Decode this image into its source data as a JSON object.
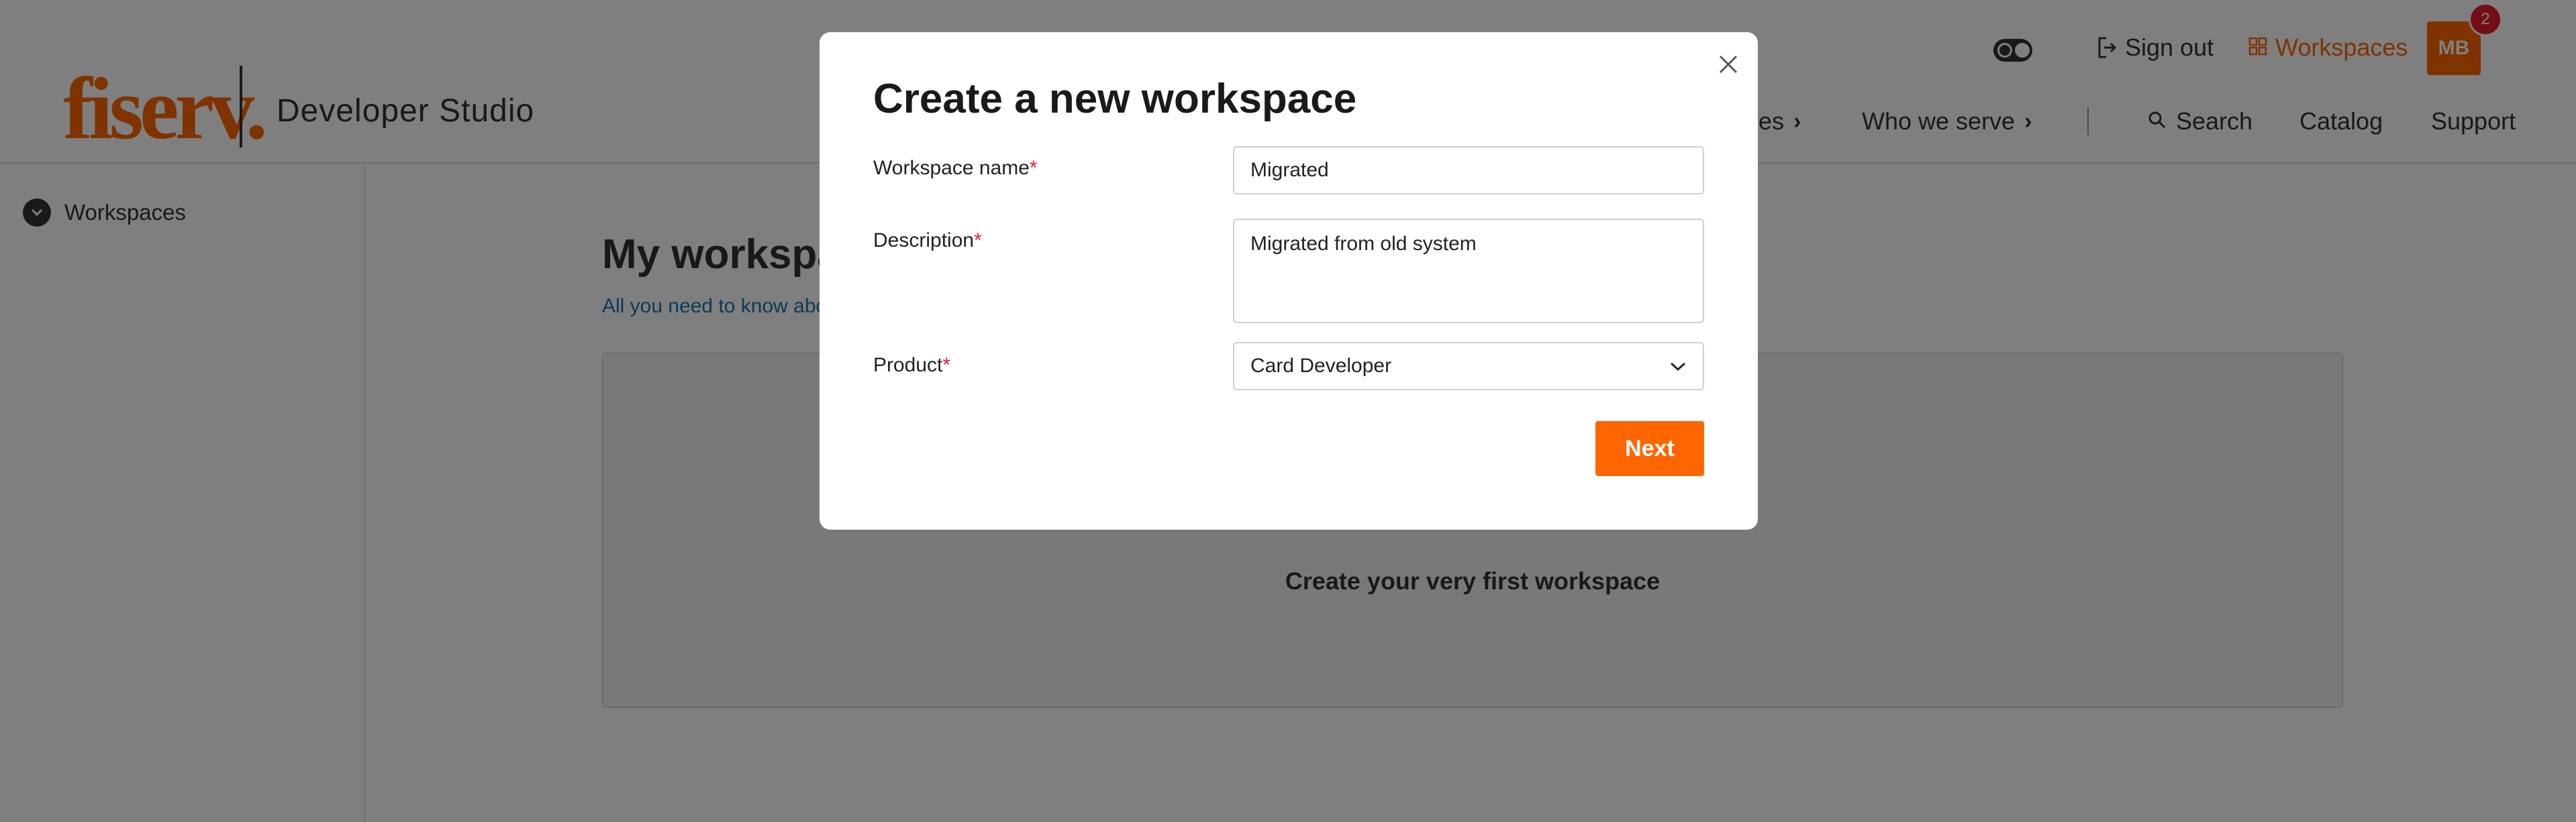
{
  "header": {
    "logo_text": "fiserv.",
    "studio_name": "Developer Studio",
    "sign_out_label": "Sign out",
    "workspaces_label": "Workspaces",
    "avatar_initials": "MB",
    "notification_count": "2",
    "nav": {
      "partial_item_label": "Resources",
      "who_we_serve_label": "Who we serve",
      "search_label": "Search",
      "catalog_label": "Catalog",
      "support_label": "Support"
    }
  },
  "sidebar": {
    "items": [
      {
        "label": "Workspaces",
        "icon": "chevron-down-icon"
      }
    ]
  },
  "main": {
    "title": "My workspaces",
    "subtitle": "All you need to know about workspaces",
    "empty_state_text": "Create your very first workspace"
  },
  "modal": {
    "title": "Create a new workspace",
    "required_marker": "*",
    "fields": {
      "name": {
        "label": "Workspace name",
        "value": "Migrated"
      },
      "description": {
        "label": "Description",
        "value": "Migrated from old system"
      },
      "product": {
        "label": "Product",
        "selected": "Card Developer"
      }
    },
    "next_label": "Next"
  },
  "colors": {
    "brand": "#ff6600",
    "required": "#e81d2d",
    "link": "#1a73b0",
    "overlay": "rgba(0,0,0,0.5)"
  }
}
